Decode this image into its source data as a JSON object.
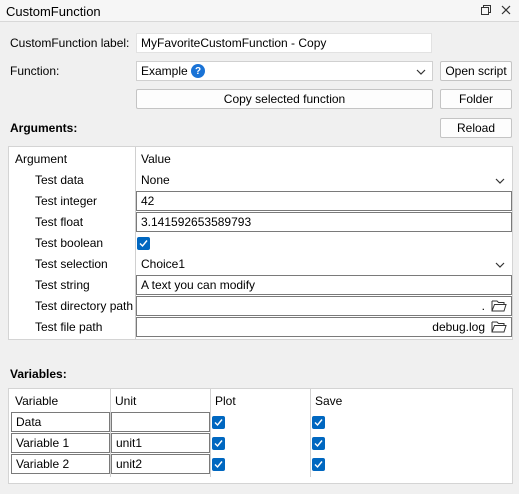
{
  "window": {
    "title": "CustomFunction"
  },
  "form": {
    "label_caption": "CustomFunction label:",
    "label_value": "MyFavoriteCustomFunction - Copy",
    "function_caption": "Function:",
    "function_value": "Example",
    "open_script": "Open script",
    "copy_selected": "Copy selected function",
    "folder": "Folder",
    "reload": "Reload"
  },
  "arguments": {
    "heading": "Arguments:",
    "col_argument": "Argument",
    "col_value": "Value",
    "rows": [
      {
        "label": "Test data",
        "value": "None",
        "kind": "combo"
      },
      {
        "label": "Test integer",
        "value": "42",
        "kind": "text"
      },
      {
        "label": "Test float",
        "value": "3.141592653589793",
        "kind": "text"
      },
      {
        "label": "Test boolean",
        "value": "",
        "kind": "check"
      },
      {
        "label": "Test selection",
        "value": "Choice1",
        "kind": "combo"
      },
      {
        "label": "Test string",
        "value": "A text you can modify",
        "kind": "text"
      },
      {
        "label": "Test directory path",
        "value": ".",
        "kind": "path"
      },
      {
        "label": "Test file path",
        "value": "debug.log",
        "kind": "path"
      }
    ]
  },
  "variables": {
    "heading": "Variables:",
    "col_variable": "Variable",
    "col_unit": "Unit",
    "col_plot": "Plot",
    "col_save": "Save",
    "rows": [
      {
        "name": "Data",
        "unit": "",
        "plot": true,
        "save": true
      },
      {
        "name": "Variable 1",
        "unit": "unit1",
        "plot": true,
        "save": true
      },
      {
        "name": "Variable 2",
        "unit": "unit2",
        "plot": true,
        "save": true
      }
    ]
  },
  "colors": {
    "accent": "#0067c0",
    "info": "#1a73d6"
  }
}
